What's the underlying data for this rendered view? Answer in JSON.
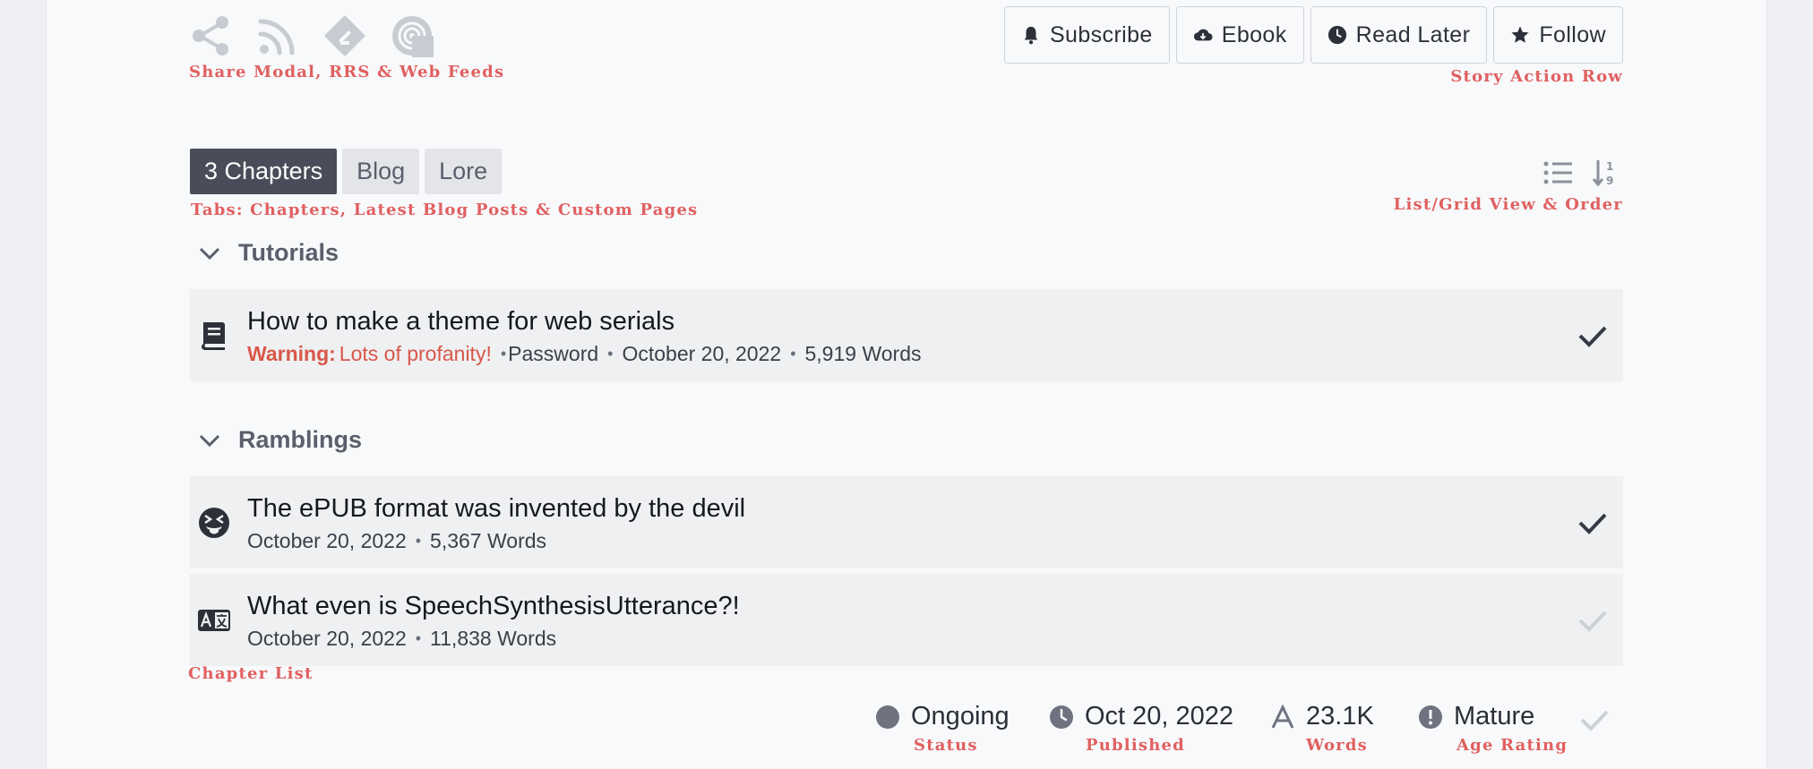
{
  "share": {
    "icons": [
      "share-icon",
      "rss-icon",
      "feedly-icon",
      "podcast-icon"
    ],
    "annotation": "Share Modal, RRS & Web Feeds"
  },
  "actions": {
    "buttons": [
      {
        "label": "Subscribe",
        "icon": "bell-icon"
      },
      {
        "label": "Ebook",
        "icon": "cloud-download-icon"
      },
      {
        "label": "Read Later",
        "icon": "clock-icon"
      },
      {
        "label": "Follow",
        "icon": "star-icon"
      }
    ],
    "annotation": "Story Action Row"
  },
  "tabs": {
    "items": [
      {
        "label": "3 Chapters",
        "active": true
      },
      {
        "label": "Blog",
        "active": false
      },
      {
        "label": "Lore",
        "active": false
      }
    ],
    "annotation": "Tabs: Chapters, Latest Blog Posts & Custom Pages"
  },
  "view": {
    "icons": [
      "list-view-icon",
      "sort-order-icon"
    ],
    "annotation": "List/Grid View & Order"
  },
  "groups": [
    {
      "name": "Tutorials",
      "chapters": [
        {
          "title": "How to make a theme for web serials",
          "warning_label": "Warning:",
          "warning_text": "Lots of profanity!",
          "password": "Password",
          "date": "October 20, 2022",
          "words": "5,919 Words",
          "icon": "book-icon",
          "read": true
        }
      ]
    },
    {
      "name": "Ramblings",
      "chapters": [
        {
          "title": "The ePUB format was invented by the devil",
          "date": "October 20, 2022",
          "words": "5,367 Words",
          "icon": "squinting-tongue-face-icon",
          "read": true
        },
        {
          "title": "What even is SpeechSynthesisUtterance?!",
          "date": "October 20, 2022",
          "words": "11,838 Words",
          "icon": "translate-icon",
          "read": false
        }
      ]
    }
  ],
  "chapter_list_annotation": "Chapter List",
  "stats": {
    "status": {
      "value": "Ongoing",
      "label": "Status"
    },
    "published": {
      "value": "Oct 20, 2022",
      "label": "Published"
    },
    "words": {
      "value": "23.1K",
      "label": "Words"
    },
    "rating": {
      "value": "Mature",
      "label": "Age Rating"
    }
  },
  "colors": {
    "annotation": "#e06060",
    "warning": "#d9574a",
    "active_tab": "#484d59",
    "check": "#363a45",
    "check_unread": "#cdd0d6"
  }
}
